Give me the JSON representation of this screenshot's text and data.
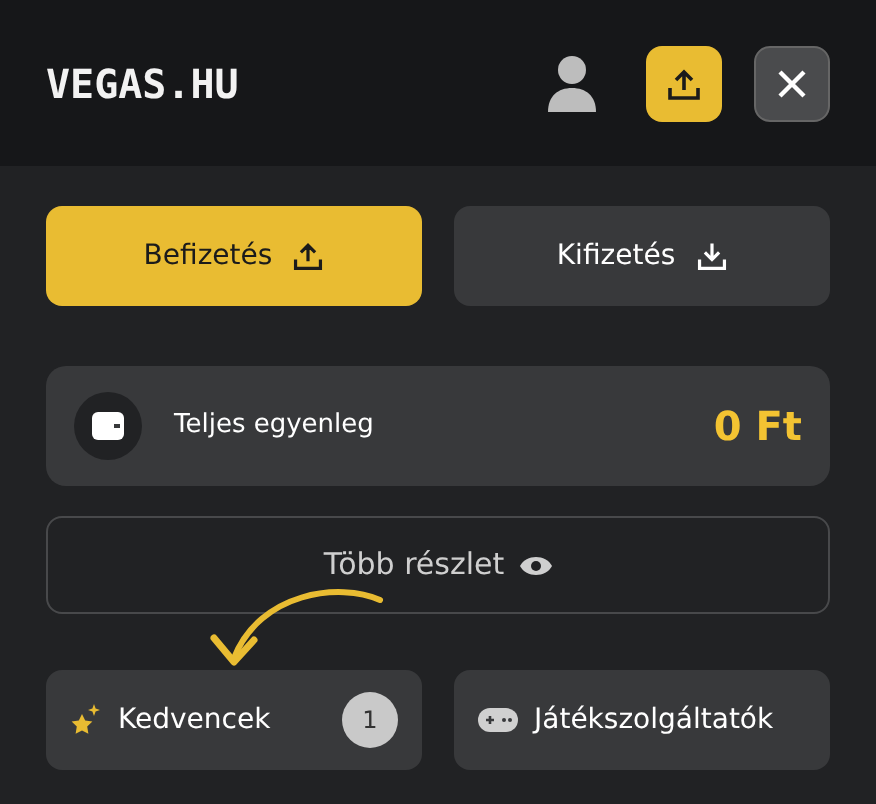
{
  "header": {
    "logo": "VEGAS.HU"
  },
  "actions": [
    {
      "label": "Befizetés",
      "kind": "deposit"
    },
    {
      "label": "Kifizetés",
      "kind": "withdraw"
    }
  ],
  "balance": {
    "label": "Teljes egyenleg",
    "amount": "0 Ft"
  },
  "details": {
    "label": "Több részlet"
  },
  "tiles": [
    {
      "label": "Kedvencek",
      "kind": "favorites",
      "count": "1"
    },
    {
      "label": "Játékszolgáltatók",
      "kind": "providers"
    }
  ]
}
